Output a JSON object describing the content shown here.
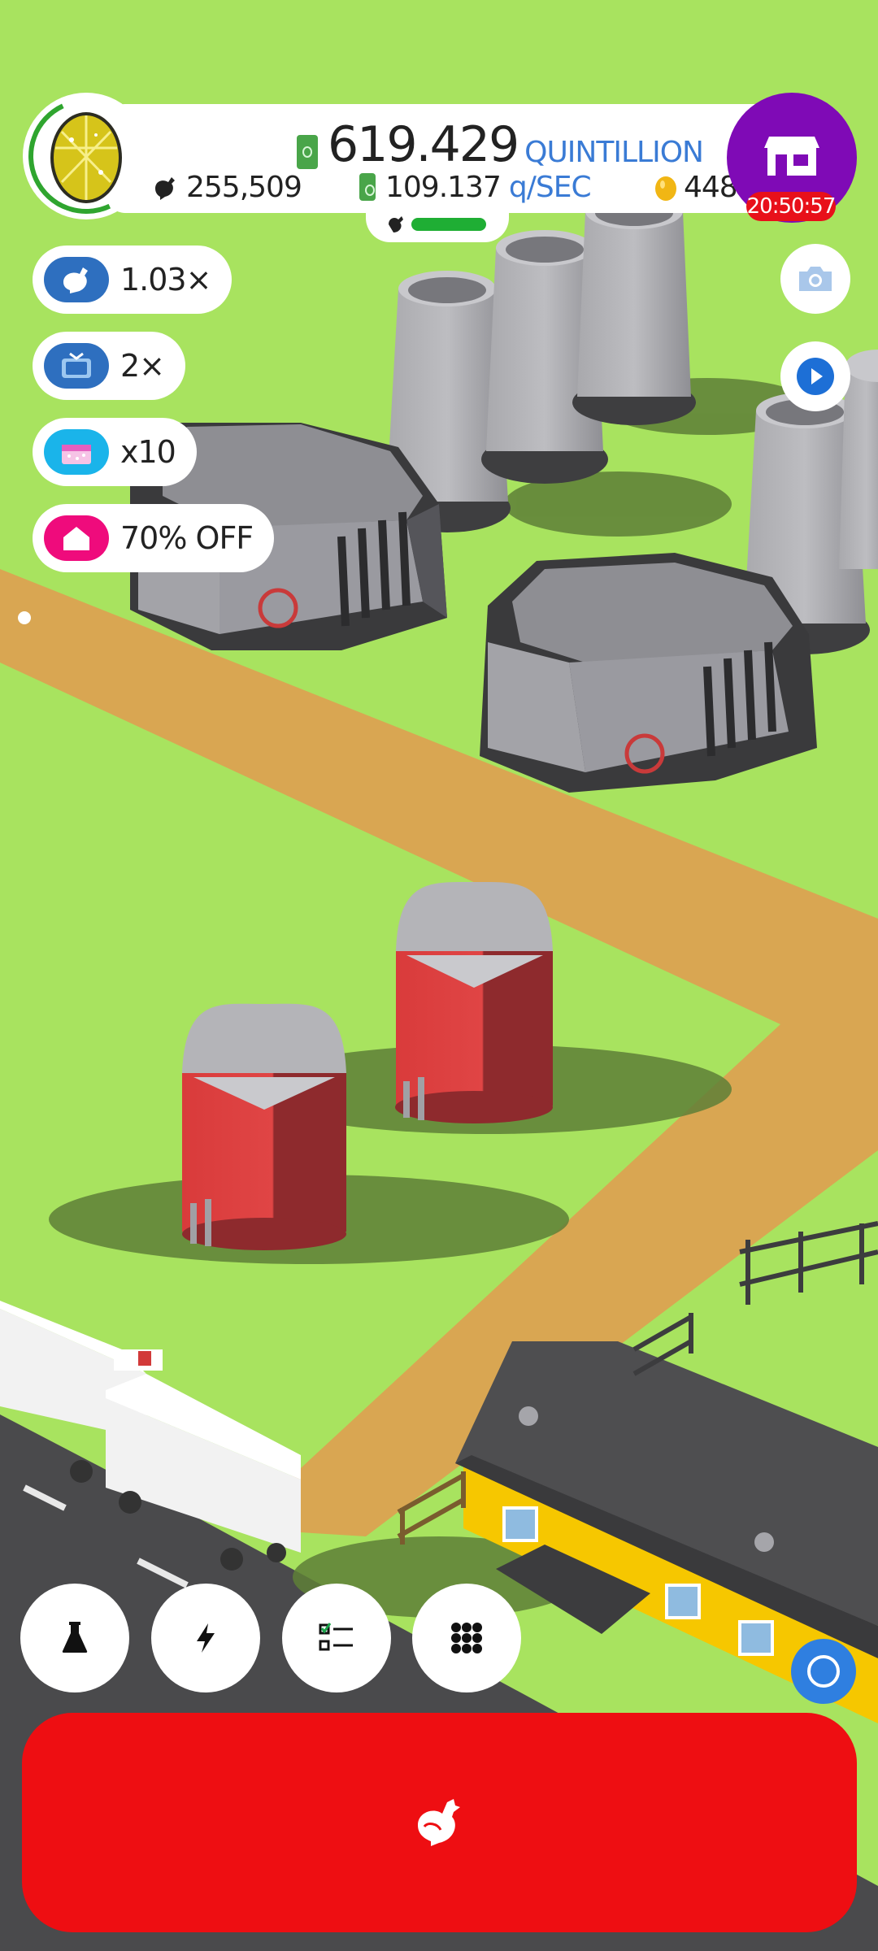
{
  "hud": {
    "money_value": "619.429",
    "money_unit": "QUINTILLION",
    "chicken_count": "255,509",
    "rate_value": "109.137",
    "rate_unit": "q/SEC",
    "golden_eggs": "448",
    "shop_timer": "20:50:57",
    "egg_progress_pct": 70,
    "hatch_progress_pct": 100
  },
  "boosts": [
    {
      "label": "1.03×",
      "icon": "chicken-icon",
      "color": "#2e6fbf"
    },
    {
      "label": "2×",
      "icon": "tv-icon",
      "color": "#2e6fbf"
    },
    {
      "label": "x10",
      "icon": "gift-box-icon",
      "color": "#1ab4ea"
    },
    {
      "label": "70% OFF",
      "icon": "house-icon",
      "color": "#ef0b7c"
    }
  ],
  "side_buttons": [
    {
      "name": "camera-button",
      "icon": "camera-icon"
    },
    {
      "name": "video-ad-button",
      "icon": "play-icon"
    }
  ],
  "toolbar": [
    {
      "name": "research-button",
      "icon": "flask-icon"
    },
    {
      "name": "boost-button",
      "icon": "lightning-icon"
    },
    {
      "name": "missions-button",
      "icon": "checklist-icon"
    },
    {
      "name": "menu-button",
      "icon": "grid-icon"
    }
  ],
  "colors": {
    "grass": "#a8e35f",
    "path": "#d9a652",
    "hatch_button": "#ee0e12",
    "shop": "#7f0ab6",
    "accent_blue": "#3a7bd5"
  }
}
